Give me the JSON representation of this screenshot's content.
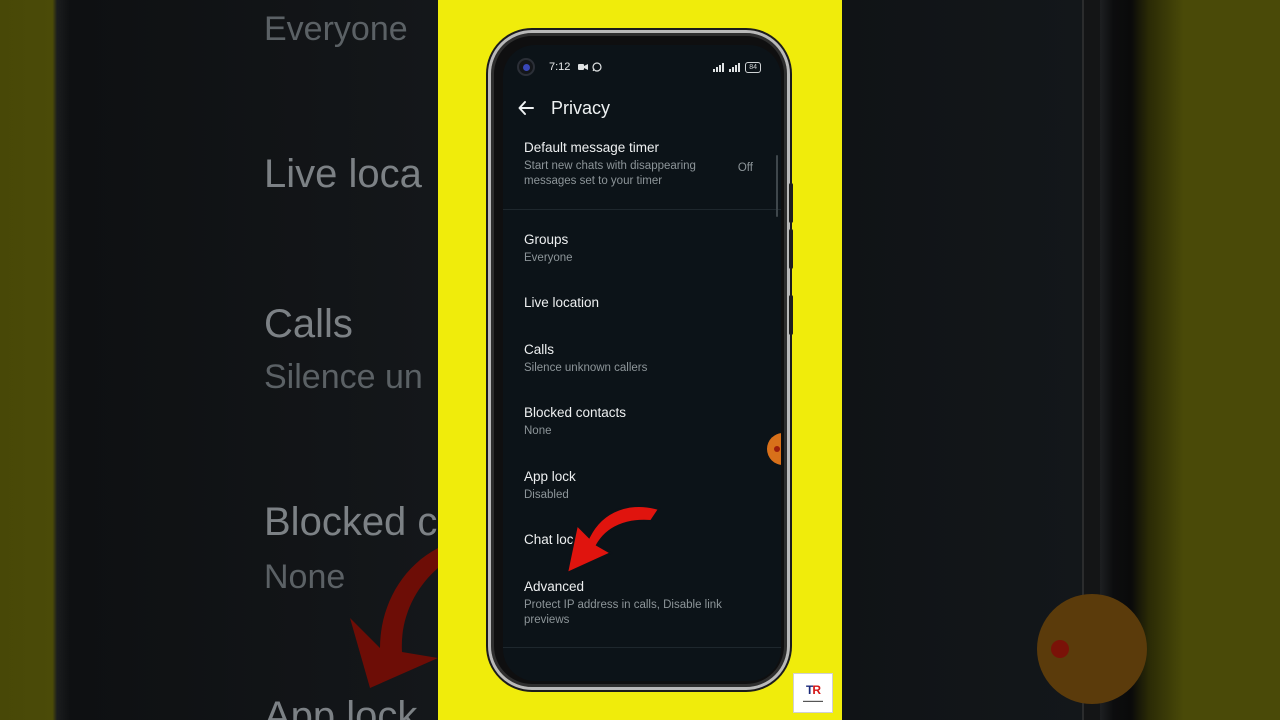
{
  "status": {
    "time": "7:12",
    "battery": "84"
  },
  "appbar": {
    "title": "Privacy",
    "back_icon": "arrow-left-icon"
  },
  "settings": [
    {
      "title": "Default message timer",
      "subtitle": "Start new chats with disappearing messages set to your timer",
      "value": "Off"
    },
    {
      "title": "Groups",
      "subtitle": "Everyone"
    },
    {
      "title": "Live location",
      "subtitle": ""
    },
    {
      "title": "Calls",
      "subtitle": "Silence unknown callers"
    },
    {
      "title": "Blocked contacts",
      "subtitle": "None"
    },
    {
      "title": "App lock",
      "subtitle": "Disabled"
    },
    {
      "title": "Chat lock",
      "subtitle": ""
    },
    {
      "title": "Advanced",
      "subtitle": "Protect IP address in calls, Disable link previews"
    }
  ],
  "background_zoom": {
    "lines": [
      "Everyone",
      "Live loca",
      "Calls",
      "Silence un",
      "Blocked c",
      "None",
      "App lock"
    ]
  },
  "watermark": {
    "logo_left": "T",
    "logo_right": "R"
  },
  "colors": {
    "panel": "#f0ec0b",
    "screen_bg": "#0c1318",
    "arrow": "#e0140e",
    "outer": "#4a4a06"
  }
}
